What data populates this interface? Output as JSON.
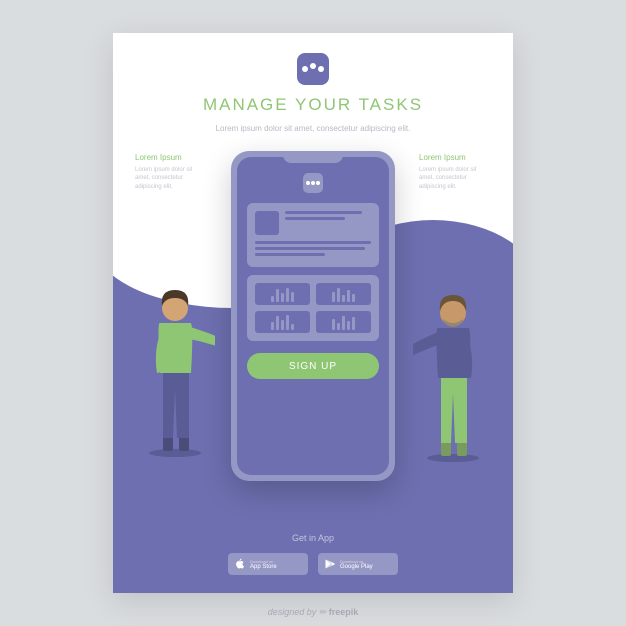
{
  "header": {
    "title": "Manage Your Tasks",
    "subtitle": "Lorem ipsum dolor sit amet, consectetur adipiscing elit."
  },
  "columns": {
    "left": {
      "title": "Lorem Ipsum",
      "text": "Lorem ipsum dolor sit amet, consectetur adipiscing elit."
    },
    "right": {
      "title": "Lorem Ipsum",
      "text": "Lorem ipsum dolor sit amet, consectetur adipiscing elit."
    }
  },
  "phone": {
    "cta": "Sign Up"
  },
  "footer": {
    "label": "Get in App",
    "apple": {
      "top": "Download on",
      "bottom": "App Store"
    },
    "google": {
      "top": "Download on",
      "bottom": "Google Play"
    }
  },
  "credit": {
    "prefix": "designed by ",
    "brand": "freepik"
  }
}
